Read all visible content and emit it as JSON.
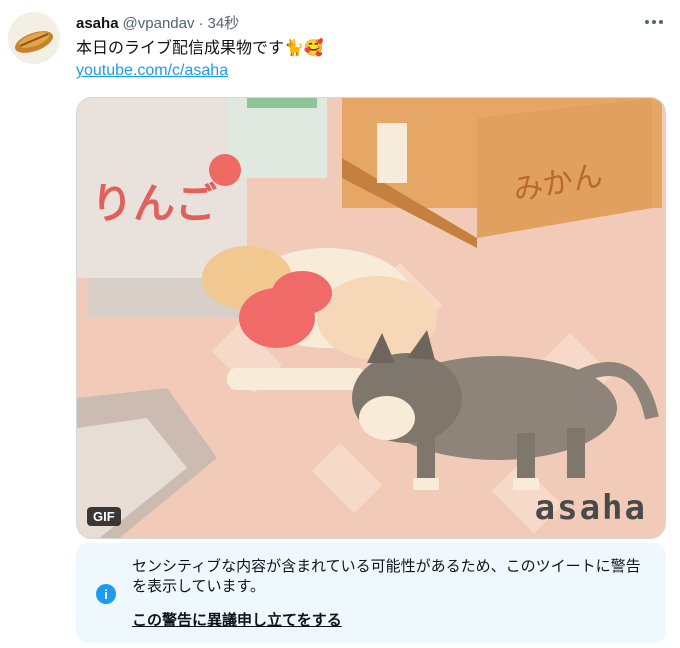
{
  "user": {
    "name": "asaha",
    "handle": "@vpandav",
    "separator": "·",
    "time": "34秒"
  },
  "tweet": {
    "text": "本日のライブ配信成果物です🐈🥰",
    "link": "youtube.com/c/asaha"
  },
  "media": {
    "badge": "GIF",
    "watermark": "asaha",
    "box_label_left": "りんご",
    "box_label_right": "みかん"
  },
  "warning": {
    "message": "センシティブな内容が含まれている可能性があるため、このツイートに警告を表示しています。",
    "action": "この警告に異議申し立てをする"
  },
  "icons": [
    "more-options-icon",
    "info-icon"
  ],
  "colors": {
    "link": "#1d9bf0",
    "warning_bg": "#eef8fd"
  }
}
